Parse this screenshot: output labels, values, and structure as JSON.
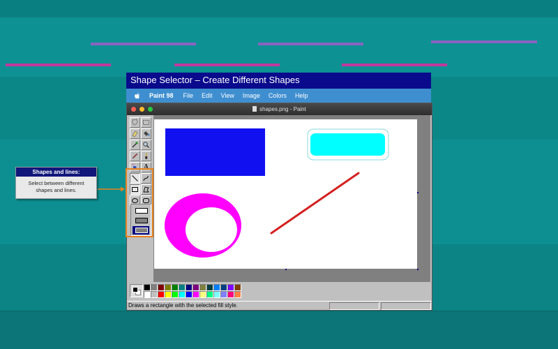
{
  "slide": {
    "title": "Shape Selector – Create Different Shapes"
  },
  "menubar": {
    "app_name": "Paint 98",
    "items": [
      "File",
      "Edit",
      "View",
      "Image",
      "Colors",
      "Help"
    ]
  },
  "window": {
    "title": "shapes.png - Paint"
  },
  "callout": {
    "heading": "Shapes and lines:",
    "body": "Select between different shapes and lines."
  },
  "statusbar": {
    "text": "Draws a rectangle with the selected fill style."
  },
  "palette": {
    "top_row": [
      "#000000",
      "#808080",
      "#800000",
      "#808000",
      "#008000",
      "#008080",
      "#000080",
      "#800080",
      "#808040",
      "#004040",
      "#0080ff",
      "#004080",
      "#8000ff",
      "#804000"
    ],
    "bottom_row": [
      "#ffffff",
      "#c0c0c0",
      "#ff0000",
      "#ffff00",
      "#00ff00",
      "#00ffff",
      "#0000ff",
      "#ff00ff",
      "#ffff80",
      "#00ff80",
      "#80ffff",
      "#8080ff",
      "#ff0080",
      "#ff8040"
    ]
  },
  "colors": {
    "slide_title_bg": "#0a0a8c",
    "menubar_bg": "#3f8fd0",
    "highlight": "#e8821e",
    "callout_head_bg": "#10167a",
    "canvas_rect_fill": "#1010f0",
    "canvas_round_rect_fill": "#00ffff",
    "canvas_ellipse_fill": "#ff00ff",
    "canvas_line": "#d42020"
  },
  "icons": {
    "tools": [
      "free-select-icon",
      "rect-select-icon",
      "eraser-icon",
      "fill-bucket-icon",
      "color-picker-icon",
      "magnifier-icon",
      "pencil-icon",
      "brush-icon",
      "airbrush-icon",
      "text-icon",
      "line-icon",
      "curve-icon",
      "rectangle-icon",
      "polygon-icon",
      "ellipse-icon",
      "rounded-rectangle-icon"
    ]
  }
}
